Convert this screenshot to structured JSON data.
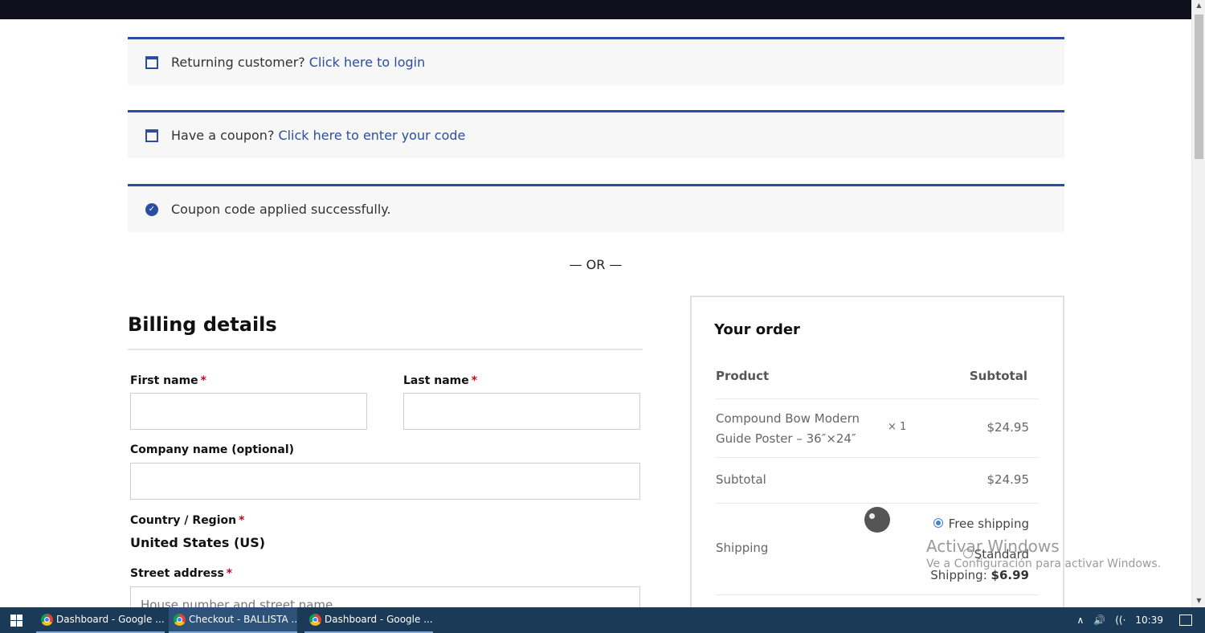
{
  "notices": {
    "login": {
      "text": "Returning customer?",
      "link": "Click here to login"
    },
    "coupon": {
      "text": "Have a coupon?",
      "link": "Click here to enter your code"
    },
    "success": {
      "text": "Coupon code applied successfully."
    }
  },
  "or_divider": "— OR —",
  "billing": {
    "title": "Billing details",
    "first_name_label": "First name",
    "last_name_label": "Last name",
    "company_label": "Company name (optional)",
    "country_label": "Country / Region",
    "country_value": "United States (US)",
    "street_label": "Street address",
    "street_placeholder": "House number and street name",
    "required_mark": "*"
  },
  "order": {
    "title": "Your order",
    "col_product": "Product",
    "col_subtotal": "Subtotal",
    "items": [
      {
        "name": "Compound Bow Modern Guide Poster – 36″×24″",
        "qty": "× 1",
        "price": "$24.95"
      }
    ],
    "subtotal_label": "Subtotal",
    "subtotal_value": "$24.95",
    "shipping_label": "Shipping",
    "shipping_free": "Free shipping",
    "shipping_standard": "Standard",
    "shipping_standard_label": "Shipping:",
    "shipping_standard_price": "$6.99"
  },
  "watermark": {
    "title": "Activar Windows",
    "subtitle": "Ve a Configuración para activar Windows."
  },
  "taskbar": {
    "tasks": [
      {
        "label": "Dashboard - Google ...",
        "active": false
      },
      {
        "label": "Checkout - BALLISTA ...",
        "active": true
      },
      {
        "label": "Dashboard - Google ...",
        "active": false
      }
    ],
    "clock": "10:39"
  },
  "colors": {
    "accent": "#2b4ea2",
    "required": "#d0021b",
    "taskbar": "#1b3a57"
  }
}
